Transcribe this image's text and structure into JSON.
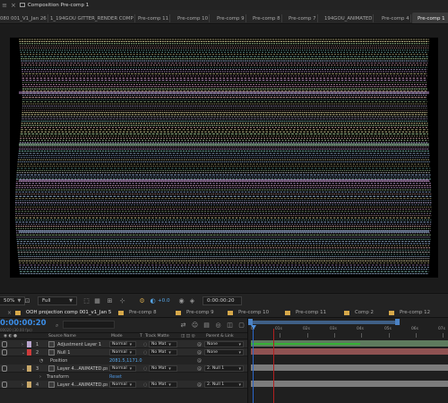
{
  "composition": {
    "panel_title": "Composition Pre-comp 1",
    "tabs": [
      {
        "label": "080 001_V1_Jan 26",
        "active": false
      },
      {
        "label": "1_194GOU GITTER_RENDER COMP",
        "active": false
      },
      {
        "label": "Pre-comp 11",
        "active": false
      },
      {
        "label": "Pre-comp 10",
        "active": false
      },
      {
        "label": "Pre-comp 9",
        "active": false
      },
      {
        "label": "Pre-comp 8",
        "active": false
      },
      {
        "label": "Pre-comp 7",
        "active": false
      },
      {
        "label": "194GOU_ANIMATED",
        "active": false
      },
      {
        "label": "Pre-comp 4",
        "active": false
      },
      {
        "label": "Pre-comp 1",
        "active": true
      }
    ]
  },
  "viewer_footer": {
    "zoom": "50%",
    "resolution": "Full",
    "exposure": "+0.0",
    "timecode": "0:00:00:20"
  },
  "timeline": {
    "tabs": [
      {
        "label": "OOH projection comp 001_v1_Jan 5",
        "active": false,
        "swatch": "#d6a84a"
      },
      {
        "label": "Pre-comp 8",
        "active": false,
        "swatch": "#d6a84a"
      },
      {
        "label": "Pre-comp 9",
        "active": false,
        "swatch": "#d6a84a"
      },
      {
        "label": "Pre-comp 10",
        "active": false,
        "swatch": "#d6a84a"
      },
      {
        "label": "Pre-comp 11",
        "active": false,
        "swatch": "#d6a84a"
      },
      {
        "label": "Comp 2",
        "active": false,
        "swatch": "#d6a84a"
      },
      {
        "label": "Pre-comp 12",
        "active": false,
        "swatch": "#d6a84a"
      }
    ],
    "current_time": "0:00:00:20",
    "current_time_sub": "00020 (30.00 fps)",
    "columns": {
      "source_name": "Source Name",
      "mode": "Mode",
      "t": "T",
      "track_matte": "Track Matte",
      "parent_link": "Parent & Link"
    },
    "ruler_labels": [
      "0f",
      "01s",
      "02s",
      "03s",
      "04s",
      "05s",
      "06s",
      "07s"
    ],
    "layers": [
      {
        "type": "layer",
        "num": "1",
        "name": "Adjustment Layer 1",
        "label_color": "#b9a6cf",
        "mode": "Normal",
        "matte": "No Mat",
        "parent": "None",
        "bar_color": "#6f8f6f"
      },
      {
        "type": "layer",
        "num": "2",
        "name": "Null 1",
        "label_color": "#cf3b3b",
        "mode": "Normal",
        "matte": "No Mat",
        "parent": "None",
        "bar_color": "#a65d5d"
      },
      {
        "type": "prop",
        "name": "Position",
        "value": "2081.5,1171.0"
      },
      {
        "type": "layer",
        "num": "3",
        "name": "Layer 4...ANIMATED.psd",
        "label_color": "#c9a86a",
        "mode": "Normal",
        "matte": "No Mat",
        "parent": "2. Null 1",
        "bar_color": "#8d8d8d"
      },
      {
        "type": "prop",
        "name": "Transform",
        "value": "Reset"
      },
      {
        "type": "layer",
        "num": "4",
        "name": "Layer 4...ANIMATED.psd",
        "label_color": "#c9a86a",
        "mode": "Normal",
        "matte": "No Mat",
        "parent": "2. Null 1",
        "bar_color": "#8d8d8d"
      }
    ]
  },
  "colors": {
    "timecode_blue": "#3b8ee8",
    "cti_red": "#b02020",
    "tab_swatch": "#d6a84a"
  }
}
